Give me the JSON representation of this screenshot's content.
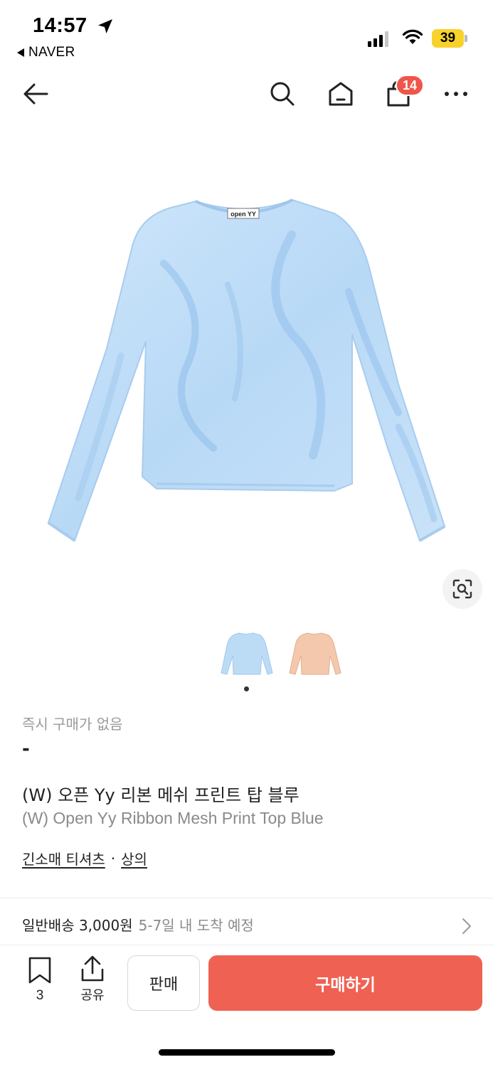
{
  "status_bar": {
    "time": "14:57",
    "back_app": "NAVER",
    "battery": "39"
  },
  "nav": {
    "cart_count": "14"
  },
  "product": {
    "price_label": "즉시 구매가 없음",
    "price_value": "-",
    "title_ko": "(W) 오픈 Yy 리본 메쉬 프린트 탑 블루",
    "title_en": "(W) Open Yy Ribbon Mesh Print Top Blue",
    "category_1": "긴소매 티셔츠",
    "category_sep": "·",
    "category_2": "상의",
    "label_tag": "open YY",
    "colors": {
      "blue": "#bcdcf6",
      "peach": "#f3c8ad"
    }
  },
  "shipping": {
    "type_and_fee": "일반배송 3,000원",
    "eta": "5-7일 내 도착 예정"
  },
  "bottom_bar": {
    "bookmark_count": "3",
    "share_label": "공유",
    "sell_label": "판매",
    "buy_label": "구매하기"
  },
  "icons": [
    "location-arrow-icon",
    "back-triangle-icon",
    "signal-icon",
    "wifi-icon",
    "battery-icon",
    "back-arrow-icon",
    "search-icon",
    "home-icon",
    "shopping-bag-icon",
    "more-icon",
    "lens-search-icon",
    "chevron-right-icon",
    "bookmark-icon",
    "share-icon"
  ]
}
